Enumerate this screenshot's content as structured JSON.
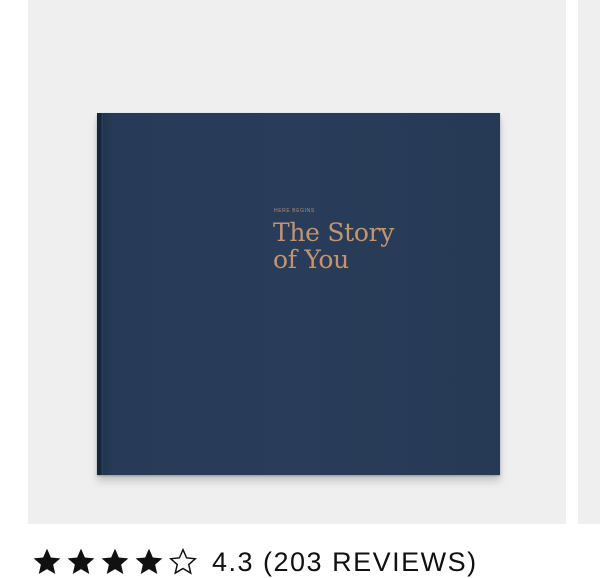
{
  "product": {
    "book_cover": {
      "kicker": "HERE BEGINS",
      "title_line1": "The Story",
      "title_line2": "of You",
      "cover_color": "#293d5a",
      "foil_color": "#c4946f"
    },
    "background_color": "#efefef"
  },
  "rating": {
    "score": "4.3",
    "filled_stars": 4,
    "max_stars": 5,
    "reviews_text": "4.3 (203 REVIEWS)",
    "icons": [
      "star-filled-icon",
      "star-filled-icon",
      "star-filled-icon",
      "star-filled-icon",
      "star-outline-icon"
    ]
  }
}
